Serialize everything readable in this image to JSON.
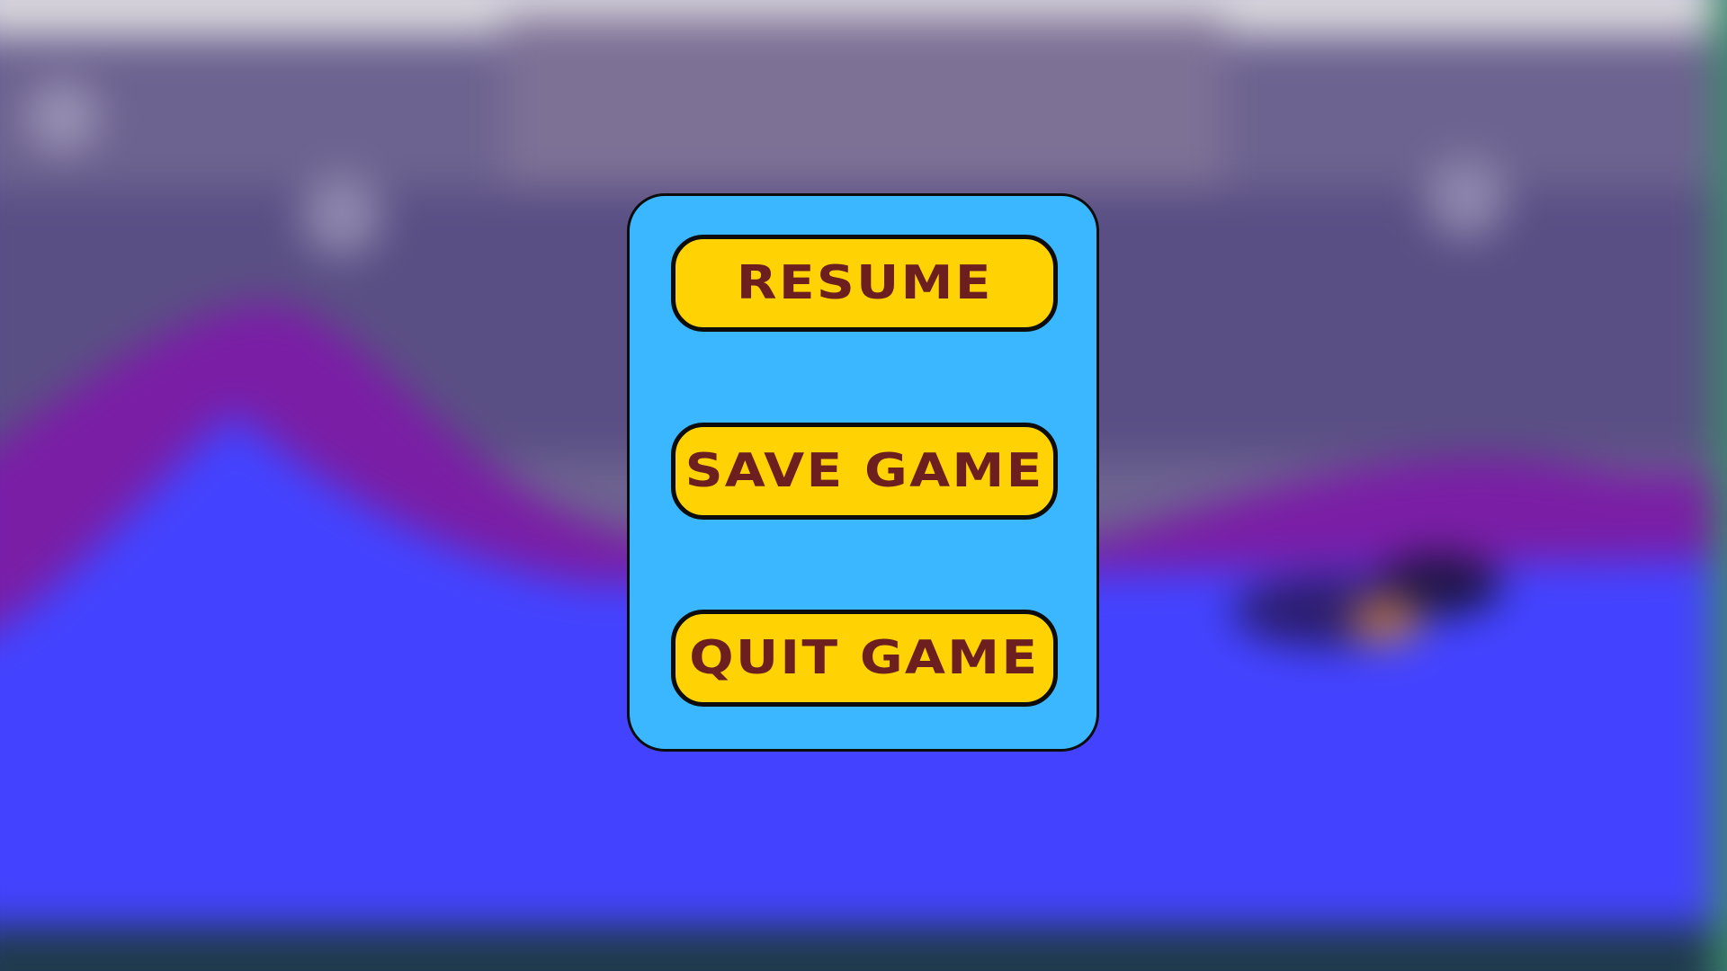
{
  "pause_menu": {
    "resume_label": "RESUME",
    "save_label": "SAVE GAME",
    "quit_label": "QUIT GAME"
  },
  "colors": {
    "panel": "#3ab7ff",
    "button": "#ffd203",
    "button_text": "#6d1f1f",
    "outline": "#0c0c0c",
    "sky": "#6e6394",
    "hills": "#7b1fa2",
    "ground": "#4343ff"
  }
}
